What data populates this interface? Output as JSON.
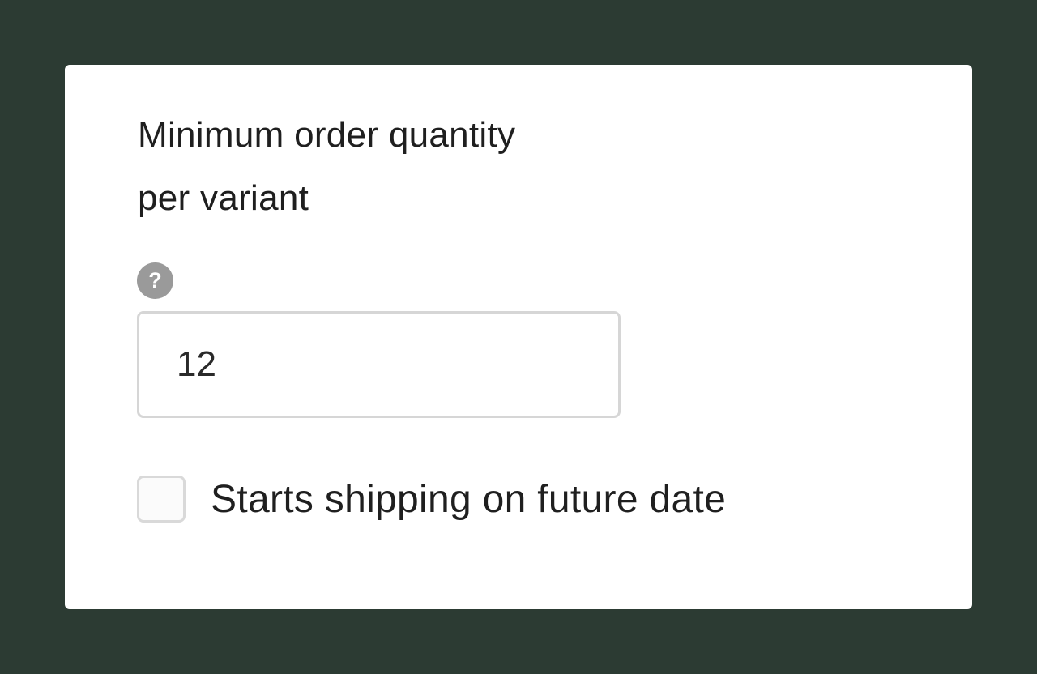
{
  "field": {
    "label_line1": "Minimum order quantity",
    "label_line2": "per variant",
    "help_icon_glyph": "?",
    "value": "12"
  },
  "shipping": {
    "checkbox_label": "Starts shipping on future date",
    "checked": false
  },
  "colors": {
    "background": "#2c3b33",
    "card": "#ffffff",
    "help_icon": "#9a9a9a"
  }
}
